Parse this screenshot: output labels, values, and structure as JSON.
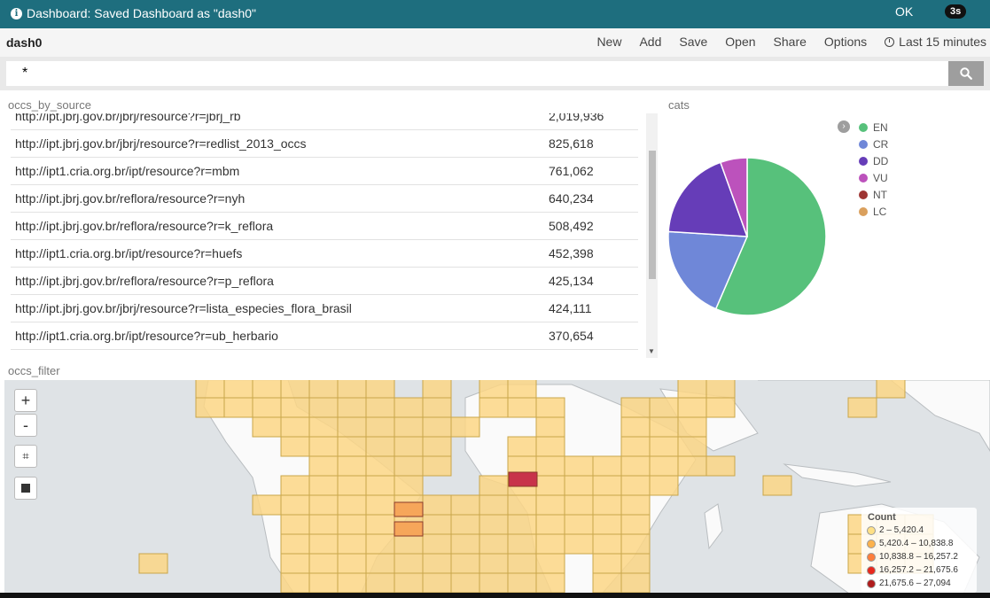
{
  "notification": {
    "message": "Dashboard: Saved Dashboard as \"dash0\"",
    "ok_label": "OK",
    "countdown": "3s"
  },
  "nav": {
    "title": "dash0",
    "menu": [
      "New",
      "Add",
      "Save",
      "Open",
      "Share",
      "Options"
    ],
    "time_label": "Last 15 minutes"
  },
  "search": {
    "query": "*"
  },
  "table_panel": {
    "title": "occs_by_source",
    "rows": [
      {
        "source": "http://ipt.jbrj.gov.br/jbrj/resource?r=jbrj_rb",
        "count": "2,019,936"
      },
      {
        "source": "http://ipt.jbrj.gov.br/jbrj/resource?r=redlist_2013_occs",
        "count": "825,618"
      },
      {
        "source": "http://ipt1.cria.org.br/ipt/resource?r=mbm",
        "count": "761,062"
      },
      {
        "source": "http://ipt.jbrj.gov.br/reflora/resource?r=nyh",
        "count": "640,234"
      },
      {
        "source": "http://ipt.jbrj.gov.br/reflora/resource?r=k_reflora",
        "count": "508,492"
      },
      {
        "source": "http://ipt1.cria.org.br/ipt/resource?r=huefs",
        "count": "452,398"
      },
      {
        "source": "http://ipt.jbrj.gov.br/reflora/resource?r=p_reflora",
        "count": "425,134"
      },
      {
        "source": "http://ipt.jbrj.gov.br/jbrj/resource?r=lista_especies_flora_brasil",
        "count": "424,111"
      },
      {
        "source": "http://ipt1.cria.org.br/ipt/resource?r=ub_herbario",
        "count": "370,654"
      }
    ]
  },
  "pie_panel": {
    "title": "cats"
  },
  "chart_data": {
    "type": "pie",
    "title": "",
    "legend_position": "top-right",
    "slices": [
      {
        "label": "EN",
        "value": 56.5,
        "color": "#57c17b"
      },
      {
        "label": "CR",
        "value": 19.5,
        "color": "#6f87d8"
      },
      {
        "label": "DD",
        "value": 18.5,
        "color": "#663db8"
      },
      {
        "label": "VU",
        "value": 5.5,
        "color": "#bc52bc"
      },
      {
        "label": "NT",
        "value": 0,
        "color": "#9e3533"
      },
      {
        "label": "LC",
        "value": 0,
        "color": "#daa05d"
      }
    ]
  },
  "map_panel": {
    "title": "occs_filter",
    "zoom_in": "+",
    "zoom_out": "-",
    "legend_title": "Count",
    "legend": [
      {
        "label": "2 – 5,420.4",
        "color": "#fee086"
      },
      {
        "label": "5,420.4 – 10,838.8",
        "color": "#fcb24c"
      },
      {
        "label": "10,838.8 – 16,257.2",
        "color": "#fd7e3b"
      },
      {
        "label": "16,257.2 – 21,675.6",
        "color": "#e8281d"
      },
      {
        "label": "21,675.6 – 27,094",
        "color": "#b01c1c"
      }
    ]
  },
  "colors": {
    "notification_bg": "#1e6e7e",
    "map_cell": "#fbd685",
    "map_cell_border": "#c9a64a",
    "map_hot": "#c8334a"
  }
}
